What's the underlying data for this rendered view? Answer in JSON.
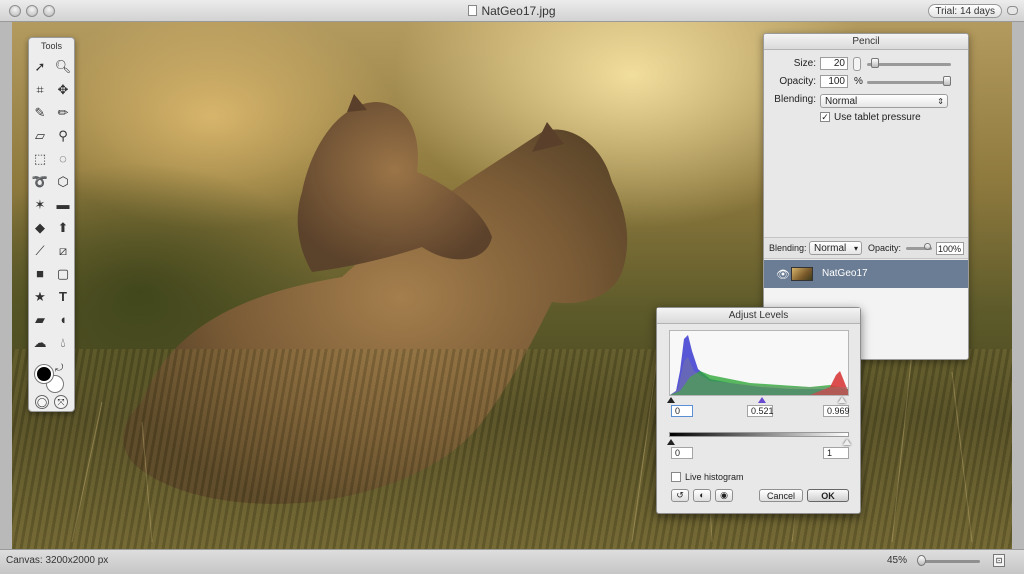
{
  "window": {
    "title": "NatGeo17.jpg",
    "trial_badge": "Trial: 14 days"
  },
  "tools": {
    "title": "Tools",
    "items": [
      "arrow-select-icon",
      "zoom-icon",
      "crop-icon",
      "move-icon",
      "brush-icon",
      "pencil-icon",
      "eraser-icon",
      "clone-stamp-icon",
      "rect-marquee-icon",
      "ellipse-marquee-icon",
      "lasso-icon",
      "polygon-lasso-icon",
      "magic-wand-icon",
      "rectangle-shape-icon",
      "paint-bucket-icon",
      "arrow-up-icon",
      "path-icon",
      "gradient-icon",
      "rect-shape-icon",
      "rounded-rect-icon",
      "star-icon",
      "text-icon",
      "smudge-icon",
      "eyedropper-icon",
      "cloud-icon",
      "drop-icon"
    ]
  },
  "pencil_panel": {
    "title": "Pencil",
    "size_label": "Size:",
    "size_value": "20",
    "size_fraction": 0.05,
    "opacity_label": "Opacity:",
    "opacity_value": "100",
    "opacity_unit": "%",
    "opacity_fraction": 1.0,
    "blending_label": "Blending:",
    "blending_value": "Normal",
    "tablet_label": "Use tablet pressure",
    "tablet_checked": true
  },
  "layers_panel": {
    "blending_label": "Blending:",
    "blending_value": "Normal",
    "opacity_label": "Opacity:",
    "opacity_value": "100%",
    "opacity_fraction": 1.0,
    "layers": [
      {
        "name": "NatGeo17",
        "visible": true
      }
    ]
  },
  "levels_dialog": {
    "title": "Adjust Levels",
    "input_black": "0",
    "input_gamma": "0.521",
    "input_white": "0.969",
    "output_black": "0",
    "output_white": "1",
    "live_histogram_label": "Live histogram",
    "live_histogram_checked": false,
    "cancel_label": "Cancel",
    "ok_label": "OK",
    "colors": {
      "blue": "#3a3ad0",
      "green": "#2fa83a",
      "red": "#d83a3a"
    }
  },
  "statusbar": {
    "canvas_info": "Canvas: 3200x2000 px",
    "zoom": "45%"
  }
}
